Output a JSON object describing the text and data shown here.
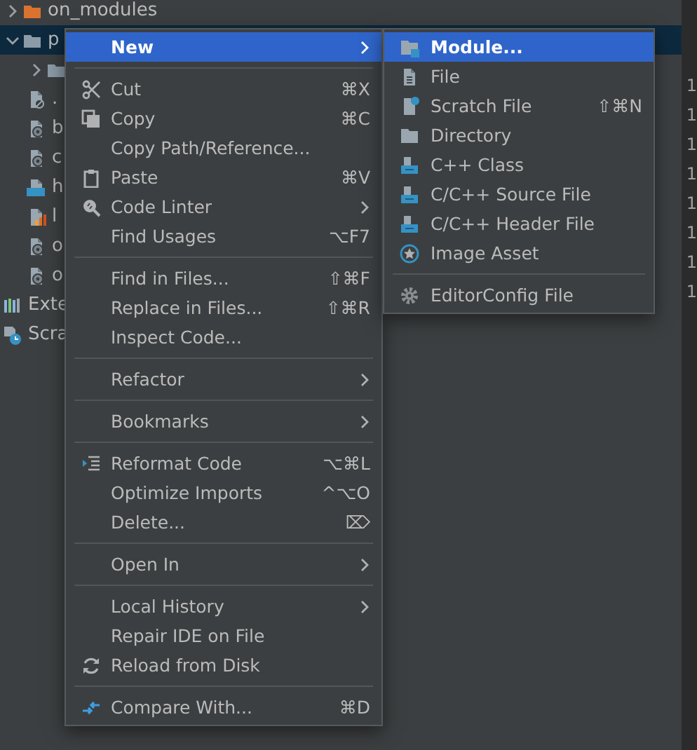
{
  "project_tree": [
    {
      "label": "on_modules",
      "kind": "excluded-folder",
      "expanded": false,
      "selected": false
    },
    {
      "label": "p",
      "kind": "folder",
      "expanded": true,
      "selected": true,
      "children": [
        {
          "kind": "folder",
          "expanded": false,
          "selected": false
        },
        {
          "label": ".",
          "kind": "ignore-file",
          "selected": false
        },
        {
          "label": "b",
          "kind": "config-file",
          "selected": false
        },
        {
          "label": "c",
          "kind": "config-file",
          "selected": false
        },
        {
          "label": "h",
          "kind": "ts-file",
          "selected": false
        },
        {
          "label": "l",
          "kind": "chart-file",
          "selected": false
        },
        {
          "label": "o",
          "kind": "config-file",
          "selected": false
        },
        {
          "label": "o",
          "kind": "config-file",
          "selected": false
        }
      ]
    },
    {
      "label": "Exte",
      "kind": "libraries",
      "selected": false
    },
    {
      "label": "Scra",
      "kind": "scratches",
      "selected": false
    }
  ],
  "line_numbers": [
    "1",
    "1",
    "1",
    "1",
    "1",
    "1",
    "1",
    "1"
  ],
  "context_menu": {
    "groups": [
      [
        {
          "label": "New",
          "submenu": true,
          "selected": true
        }
      ],
      [
        {
          "label": "Cut",
          "shortcut": "⌘X",
          "kind": "cut",
          "selected": false
        },
        {
          "label": "Copy",
          "shortcut": "⌘C",
          "kind": "copy",
          "selected": false
        },
        {
          "label": "Copy Path/Reference...",
          "selected": false
        },
        {
          "label": "Paste",
          "shortcut": "⌘V",
          "kind": "paste",
          "selected": false
        },
        {
          "label": "Code Linter",
          "submenu": true,
          "kind": "linter",
          "selected": false
        },
        {
          "label": "Find Usages",
          "shortcut": "⌥F7",
          "selected": false
        }
      ],
      [
        {
          "label": "Find in Files...",
          "shortcut": "⇧⌘F",
          "selected": false
        },
        {
          "label": "Replace in Files...",
          "shortcut": "⇧⌘R",
          "selected": false
        },
        {
          "label": "Inspect Code...",
          "selected": false
        }
      ],
      [
        {
          "label": "Refactor",
          "submenu": true,
          "selected": false
        }
      ],
      [
        {
          "label": "Bookmarks",
          "submenu": true,
          "selected": false
        }
      ],
      [
        {
          "label": "Reformat Code",
          "shortcut": "⌥⌘L",
          "kind": "reformat",
          "selected": false
        },
        {
          "label": "Optimize Imports",
          "shortcut": "^⌥O",
          "selected": false
        },
        {
          "label": "Delete...",
          "shortcut": "⌦",
          "selected": false
        }
      ],
      [
        {
          "label": "Open In",
          "submenu": true,
          "selected": false
        }
      ],
      [
        {
          "label": "Local History",
          "submenu": true,
          "selected": false
        },
        {
          "label": "Repair IDE on File",
          "selected": false
        },
        {
          "label": "Reload from Disk",
          "kind": "reload",
          "selected": false
        }
      ],
      [
        {
          "label": "Compare With...",
          "shortcut": "⌘D",
          "kind": "compare",
          "selected": false
        }
      ]
    ]
  },
  "new_submenu": {
    "groups": [
      [
        {
          "label": "Module...",
          "kind": "module",
          "selected": true
        },
        {
          "label": "File",
          "kind": "file",
          "selected": false
        },
        {
          "label": "Scratch File",
          "shortcut": "⇧⌘N",
          "kind": "scratch",
          "selected": false
        },
        {
          "label": "Directory",
          "kind": "directory",
          "selected": false
        },
        {
          "label": "C++ Class",
          "kind": "cpp-class",
          "selected": false
        },
        {
          "label": "C/C++ Source File",
          "kind": "c-source",
          "selected": false
        },
        {
          "label": "C/C++ Header File",
          "kind": "c-header",
          "selected": false
        },
        {
          "label": "Image Asset",
          "kind": "image-asset",
          "selected": false
        }
      ],
      [
        {
          "label": "EditorConfig File",
          "kind": "gear",
          "selected": false
        }
      ]
    ]
  }
}
